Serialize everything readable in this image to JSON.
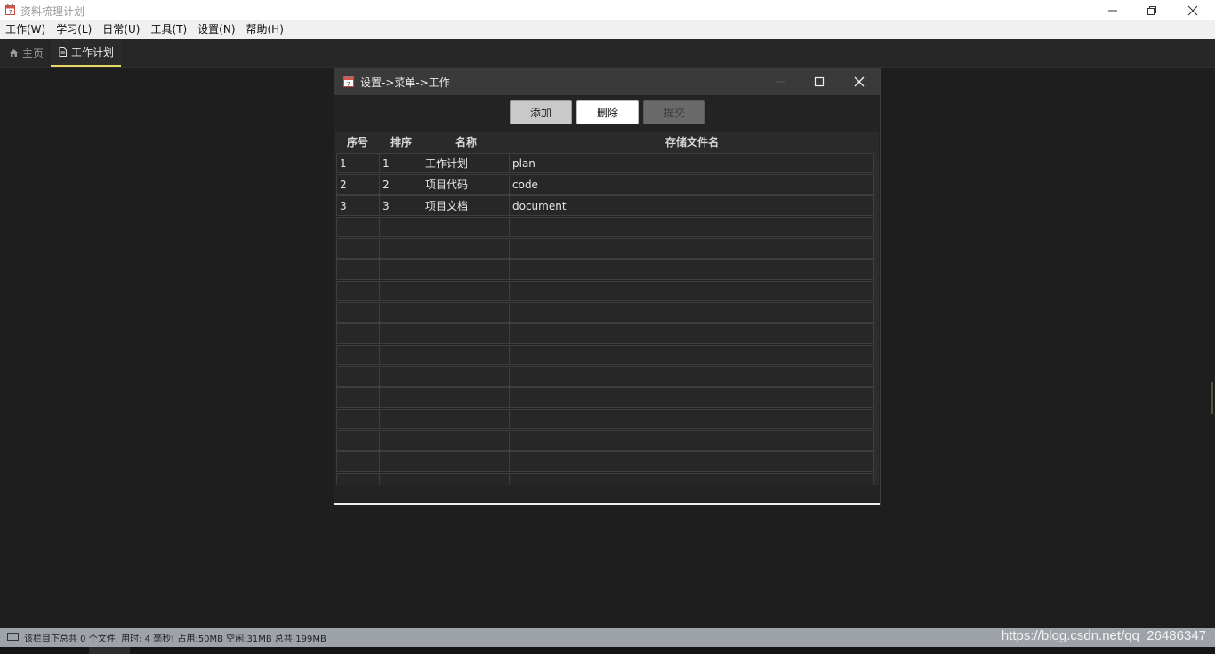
{
  "window": {
    "title": "资料梳理计划",
    "controls": [
      "minimize",
      "restore",
      "close"
    ]
  },
  "menu": {
    "items": [
      {
        "label": "工作(W)"
      },
      {
        "label": "学习(L)"
      },
      {
        "label": "日常(U)"
      },
      {
        "label": "工具(T)"
      },
      {
        "label": "设置(N)"
      },
      {
        "label": "帮助(H)"
      }
    ]
  },
  "tabs": [
    {
      "label": "主页",
      "icon": "home-icon",
      "active": false
    },
    {
      "label": "工作计划",
      "icon": "document-icon",
      "active": true
    }
  ],
  "dialog": {
    "title": "设置->菜单->工作",
    "buttons": {
      "add": "添加",
      "delete": "删除",
      "submit": "提交"
    },
    "columns": [
      "序号",
      "排序",
      "名称",
      "存储文件名"
    ],
    "rows": [
      {
        "index": "1",
        "order": "1",
        "name": "工作计划",
        "file": "plan"
      },
      {
        "index": "2",
        "order": "2",
        "name": "项目代码",
        "file": "code"
      },
      {
        "index": "3",
        "order": "3",
        "name": "项目文档",
        "file": "document"
      }
    ]
  },
  "status": {
    "text": "该栏目下总共 0 个文件, 用时: 4 毫秒! 占用:50MB 空闲:31MB 总共:199MB",
    "watermark": "https://blog.csdn.net/qq_26486347"
  },
  "colors": {
    "accent_tab_underline": "#e8d867",
    "background": "#1e1e1e",
    "statusbar": "#9ea3aa"
  }
}
